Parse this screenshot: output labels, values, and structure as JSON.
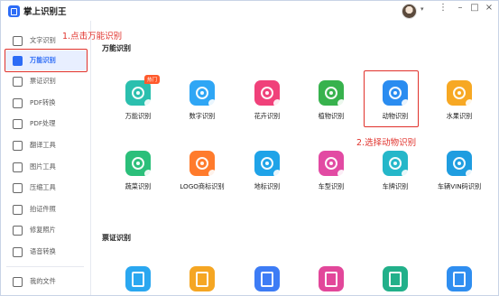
{
  "app": {
    "title": "掌上识别王"
  },
  "window_controls": {
    "menu": "⋮",
    "minimize": "–",
    "maximize": "□",
    "close": "×"
  },
  "sidebar": {
    "items": [
      {
        "label": "文字识别",
        "icon": "text-scan-icon"
      },
      {
        "label": "万能识别",
        "icon": "camera-scan-icon",
        "active": true
      },
      {
        "label": "票证识别",
        "icon": "ticket-icon"
      },
      {
        "label": "PDF转换",
        "icon": "pdf-convert-icon"
      },
      {
        "label": "PDF处理",
        "icon": "pdf-process-icon"
      },
      {
        "label": "翻译工具",
        "icon": "translate-icon"
      },
      {
        "label": "图片工具",
        "icon": "image-icon"
      },
      {
        "label": "压缩工具",
        "icon": "compress-icon"
      },
      {
        "label": "拍证件照",
        "icon": "id-photo-icon"
      },
      {
        "label": "修复照片",
        "icon": "repair-photo-icon"
      },
      {
        "label": "语音转换",
        "icon": "voice-icon"
      }
    ],
    "bottom_item": {
      "label": "我的文件",
      "icon": "folder-icon"
    }
  },
  "annotations": {
    "step1": "1.点击万能识别",
    "step2": "2.选择动物识别"
  },
  "sections": {
    "universal": {
      "title": "万能识别",
      "tools": [
        {
          "name": "万能识别",
          "color": "#2bbfae",
          "badge": "热门"
        },
        {
          "name": "数字识别",
          "color": "#2fa6f5"
        },
        {
          "name": "花卉识别",
          "color": "#f0417a"
        },
        {
          "name": "植物识别",
          "color": "#37b24d"
        },
        {
          "name": "动物识别",
          "color": "#2a8cf0"
        },
        {
          "name": "水果识别",
          "color": "#f7a823"
        },
        {
          "name": "蔬菜识别",
          "color": "#2bbf7a"
        },
        {
          "name": "LOGO商标识别",
          "color": "#ff7b2c"
        },
        {
          "name": "地标识别",
          "color": "#1fa3e8"
        },
        {
          "name": "车型识别",
          "color": "#e24aa3"
        },
        {
          "name": "车牌识别",
          "color": "#25b7c9"
        },
        {
          "name": "车辆VIN码识别",
          "color": "#1f9de0"
        }
      ]
    },
    "tickets": {
      "title": "票证识别",
      "colors": [
        "#2aa7f0",
        "#f5a623",
        "#3d7cf5",
        "#e2479a",
        "#22b08a",
        "#2f8ef0"
      ]
    }
  }
}
